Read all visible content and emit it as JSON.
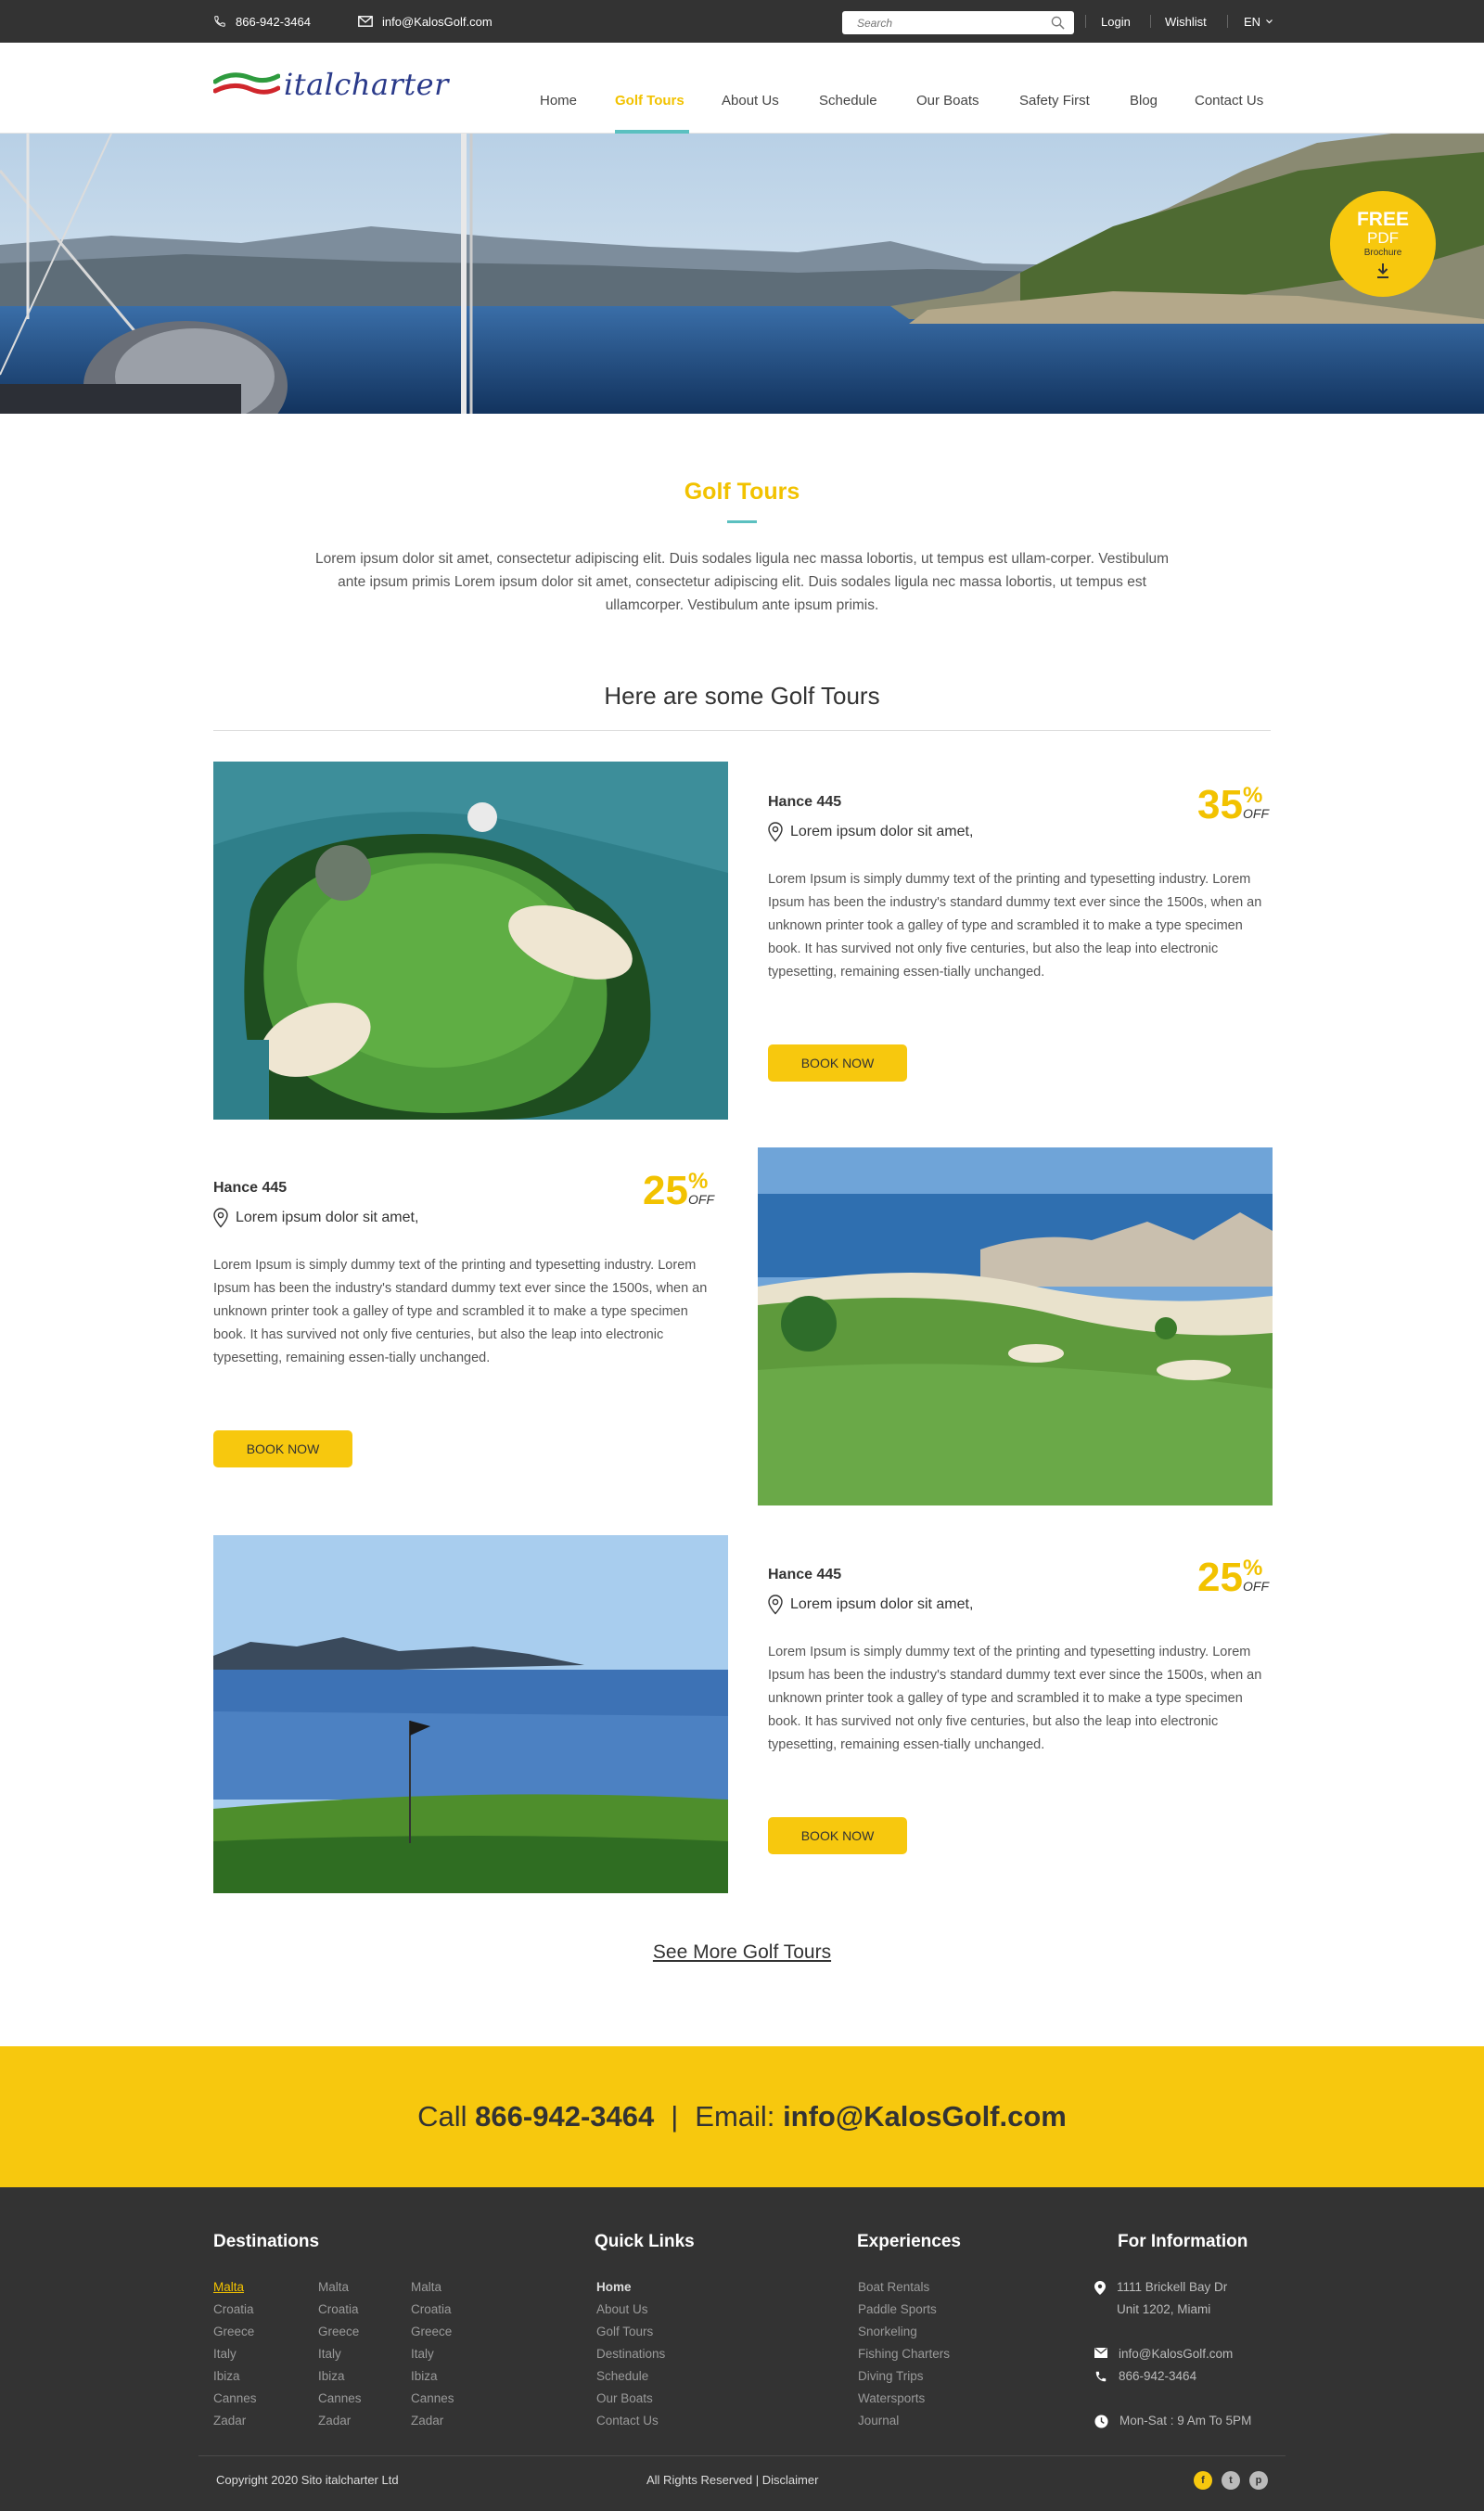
{
  "topbar": {
    "phone": "866-942-3464",
    "email": "info@KalosGolf.com",
    "search_placeholder": "Search",
    "login": "Login",
    "wishlist": "Wishlist",
    "language": "EN"
  },
  "header": {
    "logo_text": "italcharter",
    "nav": [
      "Home",
      "Golf Tours",
      "About Us",
      "Schedule",
      "Our Boats",
      "Safety First",
      "Blog",
      "Contact Us"
    ],
    "active_nav": "Golf Tours"
  },
  "brochure": {
    "line1": "FREE",
    "line2": "PDF",
    "line3": "Brochure"
  },
  "intro": {
    "title": "Golf Tours",
    "text": "Lorem ipsum dolor sit amet, consectetur adipiscing elit. Duis sodales ligula nec massa lobortis, ut tempus est ullam-corper. Vestibulum ante ipsum primis Lorem ipsum dolor sit amet, consectetur adipiscing elit. Duis sodales ligula nec massa lobortis, ut tempus est ullamcorper. Vestibulum ante ipsum primis."
  },
  "tours_heading": "Here are some Golf Tours",
  "tours": [
    {
      "name": "Hance 445",
      "location": "Lorem ipsum dolor sit amet,",
      "discount": "35",
      "percent": "%",
      "off": "OFF",
      "description": "Lorem Ipsum is simply dummy text of the printing and typesetting industry. Lorem Ipsum has been the industry's standard dummy text ever since the 1500s, when an unknown printer took a galley of type and scrambled it to make a type specimen book. It has survived not only five centuries, but also the leap into electronic typesetting, remaining essen-tially unchanged.",
      "button": "BOOK NOW"
    },
    {
      "name": "Hance 445",
      "location": "Lorem ipsum dolor sit amet,",
      "discount": "25",
      "percent": "%",
      "off": "OFF",
      "description": "Lorem Ipsum is simply dummy text of the printing and typesetting industry. Lorem Ipsum has been the industry's standard dummy text ever since the 1500s, when an unknown printer took a galley of type and scrambled it to make a type specimen book. It has survived not only five centuries, but also the leap into electronic typesetting, remaining essen-tially unchanged.",
      "button": "BOOK NOW"
    },
    {
      "name": "Hance 445",
      "location": "Lorem ipsum dolor sit amet,",
      "discount": "25",
      "percent": "%",
      "off": "OFF",
      "description": "Lorem Ipsum is simply dummy text of the printing and typesetting industry. Lorem Ipsum has been the industry's standard dummy text ever since the 1500s, when an unknown printer took a galley of type and scrambled it to make a type specimen book. It has survived not only five centuries, but also the leap into electronic typesetting, remaining essen-tially unchanged.",
      "button": "BOOK NOW"
    }
  ],
  "see_more": "See More Golf Tours",
  "callband": {
    "call_label": "Call",
    "phone": "866-942-3464",
    "separator": "|",
    "email_label": "Email:",
    "email": "info@KalosGolf.com"
  },
  "footer": {
    "destinations_title": "Destinations",
    "destinations_col1": [
      "Malta",
      "Croatia",
      "Greece",
      "Italy",
      "Ibiza",
      "Cannes",
      "Zadar"
    ],
    "destinations_col2": [
      "Malta",
      "Croatia",
      "Greece",
      "Italy",
      "Ibiza",
      "Cannes",
      "Zadar"
    ],
    "destinations_col3": [
      "Malta",
      "Croatia",
      "Greece",
      "Italy",
      "Ibiza",
      "Cannes",
      "Zadar"
    ],
    "quick_links_title": "Quick Links",
    "quick_links": [
      "Home",
      "About Us",
      "Golf Tours",
      "Destinations",
      "Schedule",
      "Our Boats",
      "Contact Us"
    ],
    "experiences_title": "Experiences",
    "experiences": [
      "Boat Rentals",
      "Paddle Sports",
      "Snorkeling",
      "Fishing Charters",
      "Diving Trips",
      "Watersports",
      "Journal"
    ],
    "info_title": "For Information",
    "address_line1": "1111 Brickell Bay Dr",
    "address_line2": "Unit 1202, Miami",
    "email": "info@KalosGolf.com",
    "phone": "866-942-3464",
    "hours": "Mon-Sat : 9 Am To 5PM",
    "copyright": "Copyright 2020 Sito italcharter Ltd",
    "rights": "All Rights Reserved | Disclaimer",
    "social": [
      "facebook-icon",
      "twitter-icon",
      "pinterest-icon"
    ]
  },
  "colors": {
    "accent_yellow": "#f7c80e",
    "accent_teal": "#5bc0c0",
    "dark": "#333333"
  }
}
